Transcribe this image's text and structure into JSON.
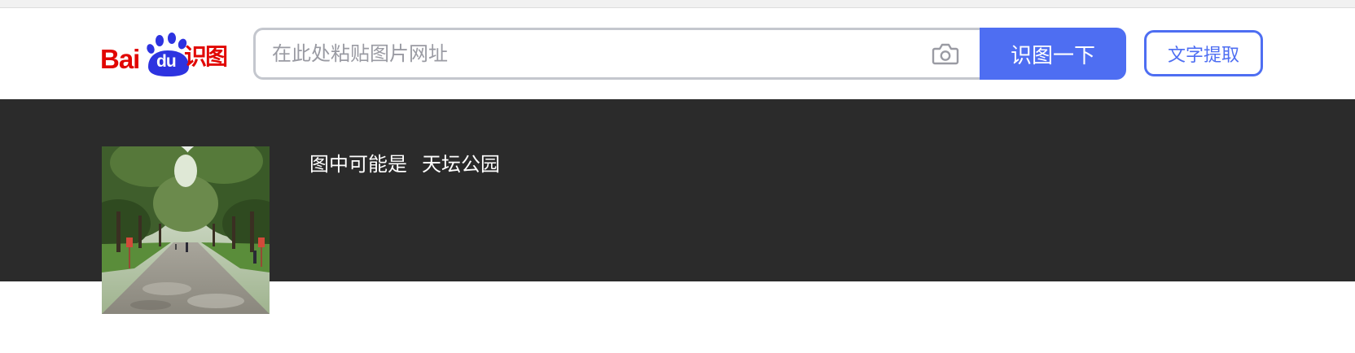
{
  "header": {
    "logo": {
      "brand_text": "Bai",
      "paw_text": "du",
      "product_text": "识图"
    },
    "search": {
      "placeholder": "在此处粘贴图片网址",
      "value": "",
      "camera_icon": "camera-icon",
      "submit_label": "识图一下"
    },
    "ocr_button_label": "文字提取"
  },
  "result": {
    "prefix": "图中可能是",
    "name": "天坛公园",
    "thumbnail_subject": "tree-lined park path"
  },
  "colors": {
    "brand_red": "#e10602",
    "brand_blue": "#4e6ef2",
    "band_bg": "#2b2b2b",
    "input_border": "#c4c7ce"
  }
}
